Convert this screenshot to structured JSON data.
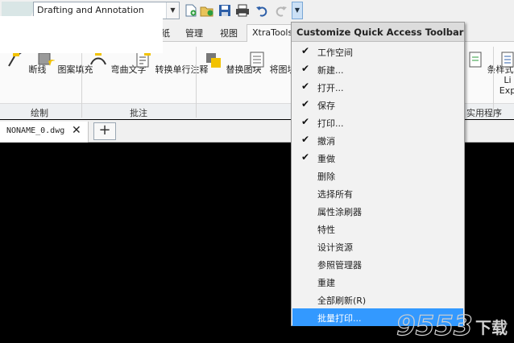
{
  "qat": {
    "workspace_value": "Drafting and Annotation",
    "icons": [
      "new-icon",
      "open-icon",
      "save-icon",
      "print-icon",
      "undo-icon",
      "redo-icon",
      "customize-arrow-icon"
    ]
  },
  "tabs": {
    "paper": "纸",
    "manage": "管理",
    "view": "视图",
    "xtratools": "XtraTools"
  },
  "ribbon": {
    "b1": "断线",
    "b2": "图案填充",
    "b3": "弯曲文字",
    "b4": "转换单行注释",
    "b5": "替换图块",
    "b6": "将图块替换",
    "b7": "条样式",
    "b8": "Li",
    "b9": "Exp",
    "group_draw": "绘制",
    "group_annot": "批注",
    "group_util": "实用程序"
  },
  "document": {
    "tab_label": "NONAME_0.dwg",
    "close": "✕",
    "add": "+"
  },
  "menu": {
    "title": "Customize Quick Access Toolbar",
    "items": [
      {
        "label": "工作空间",
        "checked": true
      },
      {
        "label": "新建...",
        "checked": true
      },
      {
        "label": "打开...",
        "checked": true
      },
      {
        "label": "保存",
        "checked": true
      },
      {
        "label": "打印...",
        "checked": true
      },
      {
        "label": "撤消",
        "checked": true
      },
      {
        "label": "重做",
        "checked": true
      },
      {
        "label": "删除",
        "checked": false
      },
      {
        "label": "选择所有",
        "checked": false
      },
      {
        "label": "属性涂刷器",
        "checked": false
      },
      {
        "label": "特性",
        "checked": false
      },
      {
        "label": "设计资源",
        "checked": false
      },
      {
        "label": "参照管理器",
        "checked": false
      },
      {
        "label": "重建",
        "checked": false
      },
      {
        "label": "全部刷新(R)",
        "checked": false
      },
      {
        "label": "批量打印...",
        "checked": false
      }
    ],
    "check_mark": "✔"
  },
  "watermark": {
    "text": "9553",
    "suffix": "下载"
  }
}
